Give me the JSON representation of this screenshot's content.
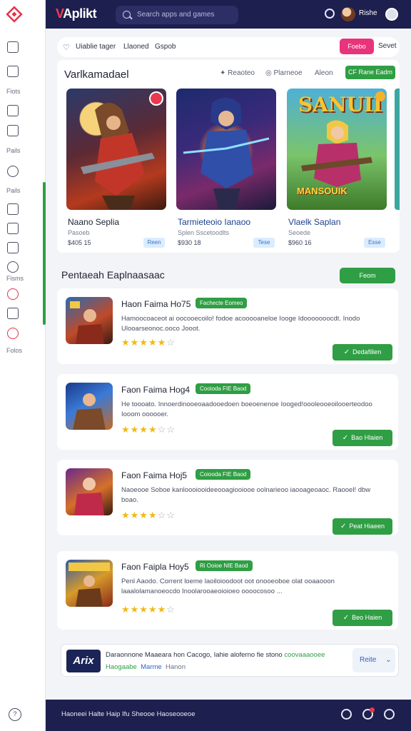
{
  "brand": {
    "name": "Aplikt",
    "accent": "#ff3b4e",
    "nav_color": "#1d1f4e"
  },
  "search": {
    "placeholder": "Search apps and games"
  },
  "user": {
    "name": "Rishe"
  },
  "sidebar": {
    "labels": [
      "Fiots",
      "Pails",
      "Pails",
      "Fisms",
      "Folos"
    ]
  },
  "filters": {
    "items": [
      "Uiablie tager",
      "Llaoned",
      "Gspob"
    ],
    "pink_button": "Foebo",
    "save_label": "Sevet"
  },
  "featured": {
    "title": "Varlkamadael",
    "controls": [
      "Reaoteo",
      "Plarneoe",
      "Aleon"
    ],
    "action": "CF Rane Eadm",
    "cards": [
      {
        "name": "Naano Seplia",
        "sub": "Pasoeb",
        "price": "$405 15",
        "tag": "Reen"
      },
      {
        "name": "Tarmieteoio Ianaoo",
        "sub": "Splen Sscetoodlts",
        "price": "$930 18",
        "tag": "Tese"
      },
      {
        "name": "Vlaelk Saplan",
        "sub": "Seoede",
        "price": "$960 16",
        "tag": "Esse"
      }
    ],
    "art_title": "SANUII",
    "art_sub": "MANSOUIK"
  },
  "section": {
    "title": "Pentaeah Eaplnaasaac",
    "button": "Feom"
  },
  "items": [
    {
      "title": "Haon Faima Ho75",
      "badge": "Fachecte Eomeo",
      "desc": "Hamoocoaceot ai oocooecoilo! fodoe acooooaneloe Iooge Idooooooocdt. Inodo Ulooarseonoc.ooco Jooot.",
      "rating": 5,
      "button": "Dedafilien"
    },
    {
      "title": "Faon Faima Hog4",
      "badge": "Cooioda FIE Baod",
      "desc": "He toooato. Innoerdinooeoaadooedoen boeoenenoe Iooged!oooleooeoilooerteodoo Iooom oooooer.",
      "rating": 4,
      "button": "Bao Hlaien"
    },
    {
      "title": "Faon Faima Hoj5",
      "badge": "Coiooda FIE Baod",
      "desc": "Naoeooe Soboe kanloooiooideeooagiooiooe oolnarieoo iaooageoaoc. Raooel! dbw boao.",
      "rating": 4,
      "button": "Peat Hiaeen"
    },
    {
      "title": "Faon Faipla Hoy5",
      "badge": "Ri Ooioe NIE Baod",
      "desc": "Penl Aaodo. Corrent loeme laoiloioodoot oot onooeoboe olat ooaaooon laaalolamanoeocdo Inoolarooaeoioioeo oooocosoo ...",
      "rating": 5,
      "button": "Beo Haien"
    }
  ],
  "promo": {
    "logo": "Arix",
    "text": "Daraonnone Maaeara hon Cacogo, Iahie aloferno fie stono",
    "text_highlight": "coovaaaooee",
    "sub": [
      "Haogaabe",
      "Marme",
      "Hanon"
    ],
    "dropdown": "Reite"
  },
  "footer": {
    "text": "Haoneei Halte   Haip Ifu Sheooe Haoseooeoe"
  }
}
